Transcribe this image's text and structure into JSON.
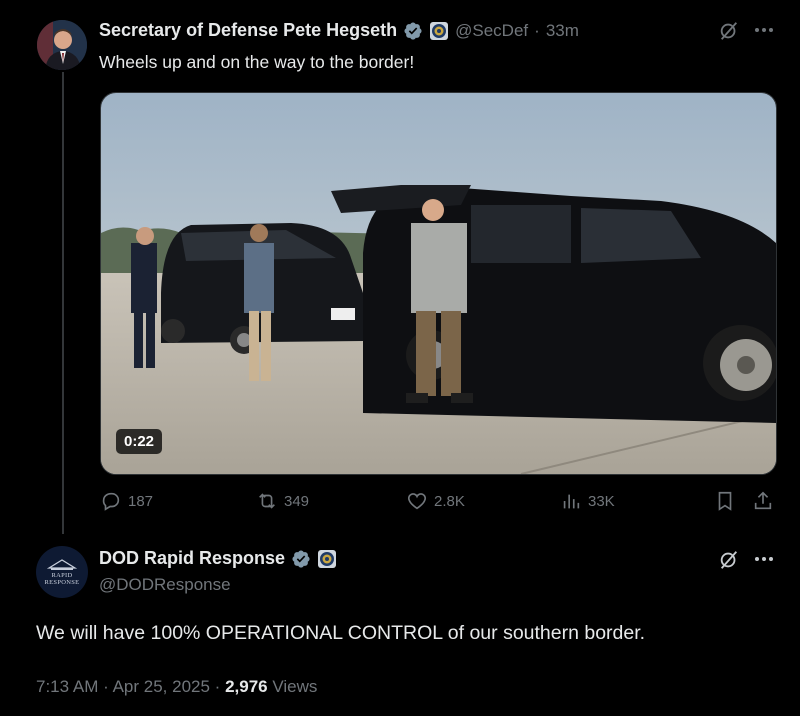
{
  "tweet1": {
    "name": "Secretary of Defense Pete Hegseth",
    "handle": "@SecDef",
    "separator": "·",
    "time": "33m",
    "text": "Wheels up and on the way to the border!",
    "video_duration": "0:22",
    "stats": {
      "replies": "187",
      "reposts": "349",
      "likes": "2.8K",
      "views": "33K"
    }
  },
  "tweet2": {
    "name": "DOD Rapid Response",
    "handle": "@DODResponse",
    "avatar_text_line1": "RAPID",
    "avatar_text_line2": "RESPONSE",
    "text": "We will have 100% OPERATIONAL CONTROL of our southern border.",
    "time": "7:13 AM",
    "sep1": "·",
    "date": "Apr 25, 2025",
    "sep2": "·",
    "views_count": "2,976",
    "views_label": "Views"
  },
  "icons": [
    "verified-badge-icon",
    "seal-icon",
    "grok-icon",
    "more-icon",
    "reply-icon",
    "repost-icon",
    "like-icon",
    "views-icon",
    "bookmark-icon",
    "share-icon"
  ],
  "colors": {
    "background": "#000000",
    "verified": "#1d9bf0",
    "muted": "#71767b",
    "text": "#e7e9ea"
  }
}
